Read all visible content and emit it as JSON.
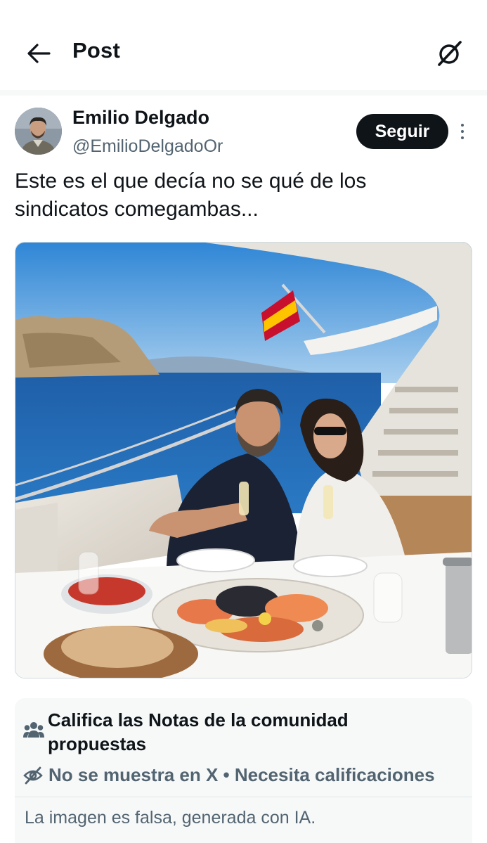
{
  "header": {
    "title": "Post",
    "back_icon": "arrow-left-icon",
    "grok_icon": "grok-icon"
  },
  "post": {
    "author_name": "Emilio Delgado",
    "author_handle": "@EmilioDelgadoOr",
    "follow_label": "Seguir",
    "more_icon": "more-vertical-icon",
    "text": "Este es el que decía no se qué de los sindicatos comegambas...",
    "media_description_icon": "photo"
  },
  "community_notes": {
    "icon": "people-icon",
    "title": "Califica las Notas de la comunidad propuestas",
    "status_icon": "eye-off-icon",
    "status": "No se muestra en X • Necesita calificaciones",
    "note_text": "La imagen es falsa, generada con IA."
  },
  "colors": {
    "text_primary": "#0f1419",
    "text_secondary": "#536471",
    "follow_bg": "#0f1419",
    "notes_bg": "#f7f9f9"
  }
}
